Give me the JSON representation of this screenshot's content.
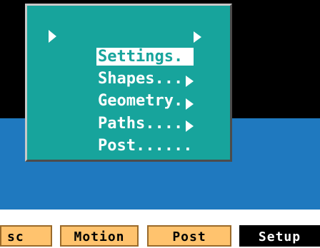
{
  "menu": {
    "items": [
      {
        "label": "Settings..",
        "selected": true
      },
      {
        "label": "Shapes....",
        "selected": false
      },
      {
        "label": "Geometry..",
        "selected": false
      },
      {
        "label": "Paths.....",
        "selected": false
      },
      {
        "label": "Post......",
        "selected": false
      }
    ]
  },
  "tabs": [
    {
      "label": "sc",
      "active": false
    },
    {
      "label": "Motion",
      "active": false
    },
    {
      "label": "Post",
      "active": false
    },
    {
      "label": "Setup",
      "active": true
    }
  ],
  "colors": {
    "background_top": "#000000",
    "background_middle": "#1f79bf",
    "menu_bg": "#17a49c",
    "menu_text": "#ffffff",
    "tab_bg": "#ffc36e",
    "active_tab_bg": "#000000"
  }
}
